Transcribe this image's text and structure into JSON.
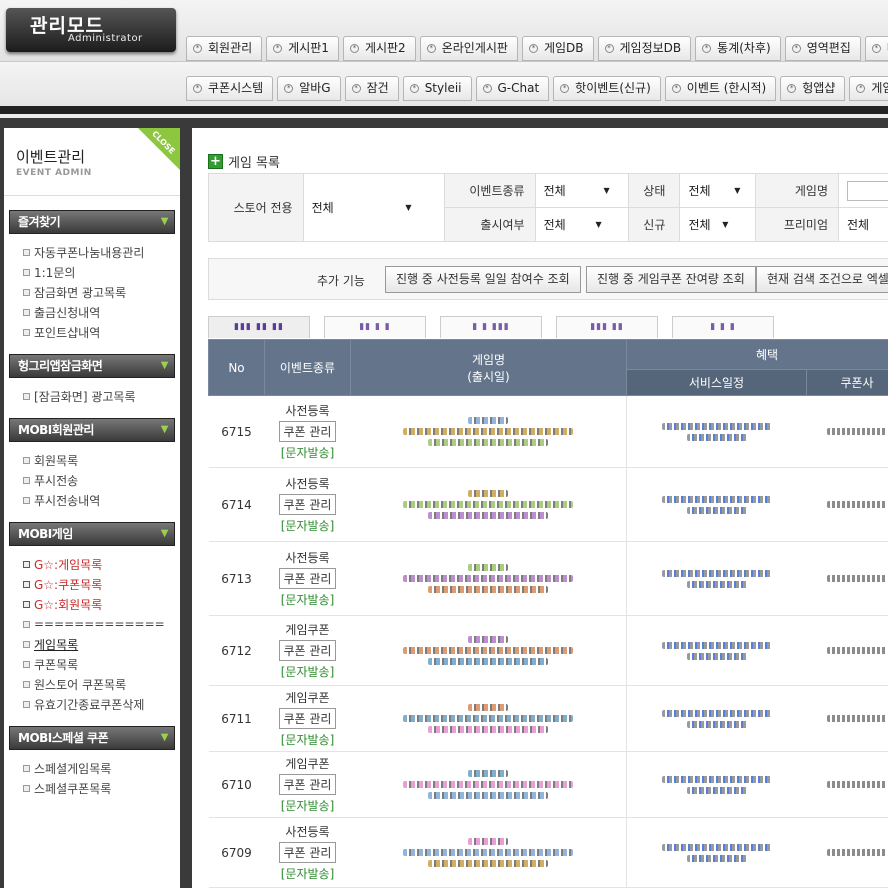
{
  "header": {
    "logo_title": "관리모드",
    "logo_sub": "Administrator"
  },
  "tabs_row1": [
    "회원관리",
    "게시판1",
    "게시판2",
    "온라인게시판",
    "게임DB",
    "게임정보DB",
    "통계(차후)",
    "영역편집",
    "배너"
  ],
  "tabs_row2": [
    "쿠폰시스템",
    "알바G",
    "잠건",
    "Styleii",
    "G-Chat",
    "핫이벤트(신규)",
    "이벤트 (한시적)",
    "헝앱샵",
    "게임미션"
  ],
  "sidebar": {
    "title": "이벤트관리",
    "subtitle": "EVENT ADMIN",
    "close_label": "CLOSE",
    "groups": [
      {
        "label": "즐겨찾기",
        "items": [
          "자동쿠폰나눔내용관리",
          "1:1문의",
          "잠금화면 광고목록",
          "출금신청내역",
          "포인트샵내역"
        ]
      },
      {
        "label": "헝그리앱잠금화면",
        "items": [
          "[잠금화면] 광고목록"
        ]
      },
      {
        "label": "MOBI회원관리",
        "items": [
          "회원목록",
          "푸시전송",
          "푸시전송내역"
        ]
      },
      {
        "label": "MOBI게임",
        "items": [
          "G☆:게임목록",
          "G☆:쿠폰목록",
          "G☆:회원목록",
          "=============",
          "게임목록",
          "쿠폰목록",
          "원스토어 쿠폰목록",
          "유효기간종료쿠폰삭제"
        ]
      },
      {
        "label": "MOBI스페셜 쿠폰",
        "items": [
          "스페셜게임목록",
          "스페셜쿠폰목록"
        ]
      }
    ]
  },
  "main": {
    "title": "게임 목록",
    "filter": {
      "store_label": "스토어 전용",
      "store_value": "전체",
      "event_type_label": "이벤트종류",
      "event_type_value": "전체",
      "status_label": "상태",
      "status_value": "전체",
      "game_name_label": "게임명",
      "release_label": "출시여부",
      "release_value": "전체",
      "new_label": "신규",
      "new_value": "전체",
      "premium_label": "프리미엄",
      "premium_value": "전체"
    },
    "func": {
      "label": "추가 기능",
      "btn1": "진행 중 사전등록 일일 참여수 조회",
      "btn2": "진행 중 게임쿠폰 잔여량 조회",
      "btn3": "현재 검색 조건으로 엑셀"
    },
    "table": {
      "col_no": "No",
      "col_event": "이벤트종류",
      "col_game": "게임명",
      "col_game_sub": "(출시일)",
      "col_benefit": "혜택",
      "col_service": "서비스일정",
      "col_coupon": "쿠폰사",
      "coupon_btn": "쿠폰 관리",
      "sms_label": "[문자발송]",
      "rows": [
        {
          "no": "6715",
          "type": "사전등록"
        },
        {
          "no": "6714",
          "type": "사전등록"
        },
        {
          "no": "6713",
          "type": "사전등록"
        },
        {
          "no": "6712",
          "type": "게임쿠폰"
        },
        {
          "no": "6711",
          "type": "게임쿠폰"
        },
        {
          "no": "6710",
          "type": "게임쿠폰"
        },
        {
          "no": "6709",
          "type": "사전등록"
        }
      ]
    }
  },
  "colors": {
    "header_bg": "#64748a",
    "accent_green": "#8dc63f",
    "sidebar_dark": "#3a3a3a",
    "link_red": "#c82a2a"
  }
}
